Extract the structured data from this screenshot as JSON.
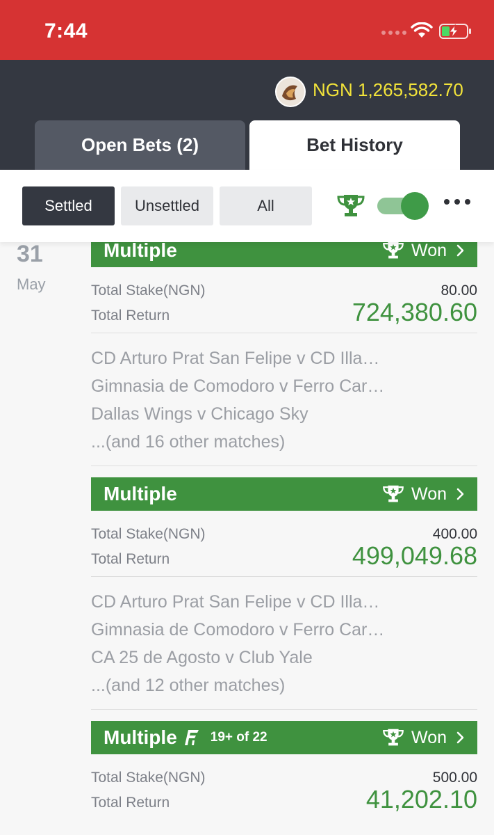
{
  "status_bar": {
    "time": "7:44"
  },
  "account": {
    "balance": "NGN 1,265,582.70"
  },
  "tabs": [
    {
      "label": "Open Bets (2)"
    },
    {
      "label": "Bet History"
    }
  ],
  "filters": {
    "settled": "Settled",
    "unsettled": "Unsettled",
    "all": "All"
  },
  "date": {
    "day": "31",
    "month": "May"
  },
  "bets": [
    {
      "type": "Multiple",
      "status": "Won",
      "stake_label": "Total Stake(NGN)",
      "stake": "80.00",
      "return_label": "Total Return",
      "return": "724,380.60",
      "matches": [
        "CD Arturo Prat San Felipe v CD Illa…",
        "Gimnasia de Comodoro v Ferro Car…",
        "Dallas Wings v Chicago Sky",
        "...(and 16 other matches)"
      ]
    },
    {
      "type": "Multiple",
      "status": "Won",
      "stake_label": "Total Stake(NGN)",
      "stake": "400.00",
      "return_label": "Total Return",
      "return": "499,049.68",
      "matches": [
        "CD Arturo Prat San Felipe v CD Illa…",
        "Gimnasia de Comodoro v Ferro Car…",
        "CA 25 de Agosto v Club Yale",
        "...(and 12 other matches)"
      ]
    },
    {
      "type": "Multiple",
      "flex": "19+ of 22",
      "status": "Won",
      "stake_label": "Total Stake(NGN)",
      "stake": "500.00",
      "return_label": "Total Return",
      "return": "41,202.10"
    }
  ],
  "colors": {
    "status_bar": "#d63333",
    "header_bg": "#343841",
    "balance": "#f2e33a",
    "won_green": "#3f923f"
  },
  "icons": [
    "wifi-icon",
    "battery-charging-icon",
    "trophy-icon",
    "chevron-right-icon",
    "more-icon",
    "flex-icon"
  ]
}
